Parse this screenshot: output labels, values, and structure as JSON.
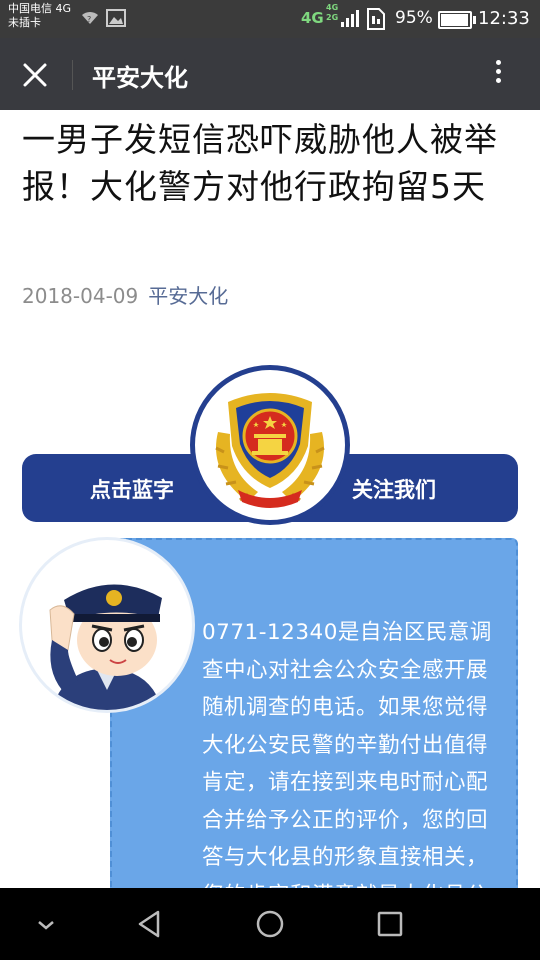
{
  "status_bar": {
    "carrier_line1": "中国电信 4G",
    "carrier_line2": "未插卡",
    "network": "4G",
    "network_small_top": "4G",
    "network_small_bottom": "2G",
    "battery_percent": "95%",
    "battery_level": 0.95,
    "time": "12:33"
  },
  "titlebar": {
    "title": "平安大化"
  },
  "article": {
    "title": "一男子发短信恐吓威胁他人被举报！大化警方对他行政拘留5天",
    "date": "2018-04-09",
    "author": "平安大化"
  },
  "follow_banner": {
    "left_text": "点击蓝字",
    "right_text": "关注我们"
  },
  "notice": {
    "text": "0771-12340是自治区民意调查中心对社会公众安全感开展随机调查的电话。如果您觉得大化公安民警的辛勤付出值得肯定，请在接到来电时耐心配合并给予公正的评价，您的回答与大化县的形象直接相关，您的肯定和满意就是大化县公安民警的最大工作"
  },
  "colors": {
    "titlebar_bg": "#393a3f",
    "banner_blue": "#243f8f",
    "notice_blue": "#6aa6e8",
    "author_link": "#576b95"
  },
  "icons": {
    "close": "close-icon",
    "more": "more-vertical-icon",
    "back": "back-triangle-icon",
    "home": "home-circle-icon",
    "recents": "recents-square-icon"
  }
}
